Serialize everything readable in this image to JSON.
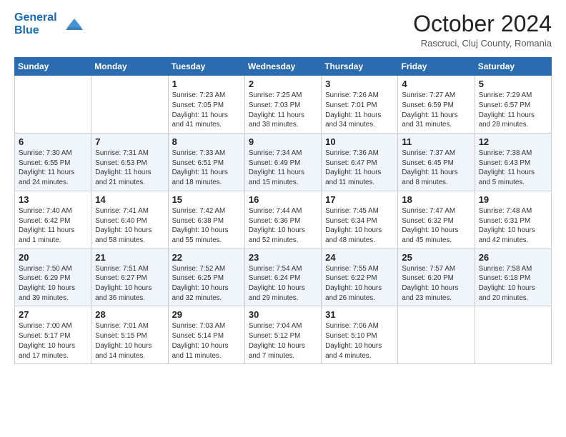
{
  "logo": {
    "line1": "General",
    "line2": "Blue"
  },
  "title": "October 2024",
  "subtitle": "Rascruci, Cluj County, Romania",
  "days_of_week": [
    "Sunday",
    "Monday",
    "Tuesday",
    "Wednesday",
    "Thursday",
    "Friday",
    "Saturday"
  ],
  "weeks": [
    [
      {
        "day": "",
        "info": ""
      },
      {
        "day": "",
        "info": ""
      },
      {
        "day": "1",
        "info": "Sunrise: 7:23 AM\nSunset: 7:05 PM\nDaylight: 11 hours and 41 minutes."
      },
      {
        "day": "2",
        "info": "Sunrise: 7:25 AM\nSunset: 7:03 PM\nDaylight: 11 hours and 38 minutes."
      },
      {
        "day": "3",
        "info": "Sunrise: 7:26 AM\nSunset: 7:01 PM\nDaylight: 11 hours and 34 minutes."
      },
      {
        "day": "4",
        "info": "Sunrise: 7:27 AM\nSunset: 6:59 PM\nDaylight: 11 hours and 31 minutes."
      },
      {
        "day": "5",
        "info": "Sunrise: 7:29 AM\nSunset: 6:57 PM\nDaylight: 11 hours and 28 minutes."
      }
    ],
    [
      {
        "day": "6",
        "info": "Sunrise: 7:30 AM\nSunset: 6:55 PM\nDaylight: 11 hours and 24 minutes."
      },
      {
        "day": "7",
        "info": "Sunrise: 7:31 AM\nSunset: 6:53 PM\nDaylight: 11 hours and 21 minutes."
      },
      {
        "day": "8",
        "info": "Sunrise: 7:33 AM\nSunset: 6:51 PM\nDaylight: 11 hours and 18 minutes."
      },
      {
        "day": "9",
        "info": "Sunrise: 7:34 AM\nSunset: 6:49 PM\nDaylight: 11 hours and 15 minutes."
      },
      {
        "day": "10",
        "info": "Sunrise: 7:36 AM\nSunset: 6:47 PM\nDaylight: 11 hours and 11 minutes."
      },
      {
        "day": "11",
        "info": "Sunrise: 7:37 AM\nSunset: 6:45 PM\nDaylight: 11 hours and 8 minutes."
      },
      {
        "day": "12",
        "info": "Sunrise: 7:38 AM\nSunset: 6:43 PM\nDaylight: 11 hours and 5 minutes."
      }
    ],
    [
      {
        "day": "13",
        "info": "Sunrise: 7:40 AM\nSunset: 6:42 PM\nDaylight: 11 hours and 1 minute."
      },
      {
        "day": "14",
        "info": "Sunrise: 7:41 AM\nSunset: 6:40 PM\nDaylight: 10 hours and 58 minutes."
      },
      {
        "day": "15",
        "info": "Sunrise: 7:42 AM\nSunset: 6:38 PM\nDaylight: 10 hours and 55 minutes."
      },
      {
        "day": "16",
        "info": "Sunrise: 7:44 AM\nSunset: 6:36 PM\nDaylight: 10 hours and 52 minutes."
      },
      {
        "day": "17",
        "info": "Sunrise: 7:45 AM\nSunset: 6:34 PM\nDaylight: 10 hours and 48 minutes."
      },
      {
        "day": "18",
        "info": "Sunrise: 7:47 AM\nSunset: 6:32 PM\nDaylight: 10 hours and 45 minutes."
      },
      {
        "day": "19",
        "info": "Sunrise: 7:48 AM\nSunset: 6:31 PM\nDaylight: 10 hours and 42 minutes."
      }
    ],
    [
      {
        "day": "20",
        "info": "Sunrise: 7:50 AM\nSunset: 6:29 PM\nDaylight: 10 hours and 39 minutes."
      },
      {
        "day": "21",
        "info": "Sunrise: 7:51 AM\nSunset: 6:27 PM\nDaylight: 10 hours and 36 minutes."
      },
      {
        "day": "22",
        "info": "Sunrise: 7:52 AM\nSunset: 6:25 PM\nDaylight: 10 hours and 32 minutes."
      },
      {
        "day": "23",
        "info": "Sunrise: 7:54 AM\nSunset: 6:24 PM\nDaylight: 10 hours and 29 minutes."
      },
      {
        "day": "24",
        "info": "Sunrise: 7:55 AM\nSunset: 6:22 PM\nDaylight: 10 hours and 26 minutes."
      },
      {
        "day": "25",
        "info": "Sunrise: 7:57 AM\nSunset: 6:20 PM\nDaylight: 10 hours and 23 minutes."
      },
      {
        "day": "26",
        "info": "Sunrise: 7:58 AM\nSunset: 6:18 PM\nDaylight: 10 hours and 20 minutes."
      }
    ],
    [
      {
        "day": "27",
        "info": "Sunrise: 7:00 AM\nSunset: 5:17 PM\nDaylight: 10 hours and 17 minutes."
      },
      {
        "day": "28",
        "info": "Sunrise: 7:01 AM\nSunset: 5:15 PM\nDaylight: 10 hours and 14 minutes."
      },
      {
        "day": "29",
        "info": "Sunrise: 7:03 AM\nSunset: 5:14 PM\nDaylight: 10 hours and 11 minutes."
      },
      {
        "day": "30",
        "info": "Sunrise: 7:04 AM\nSunset: 5:12 PM\nDaylight: 10 hours and 7 minutes."
      },
      {
        "day": "31",
        "info": "Sunrise: 7:06 AM\nSunset: 5:10 PM\nDaylight: 10 hours and 4 minutes."
      },
      {
        "day": "",
        "info": ""
      },
      {
        "day": "",
        "info": ""
      }
    ]
  ]
}
